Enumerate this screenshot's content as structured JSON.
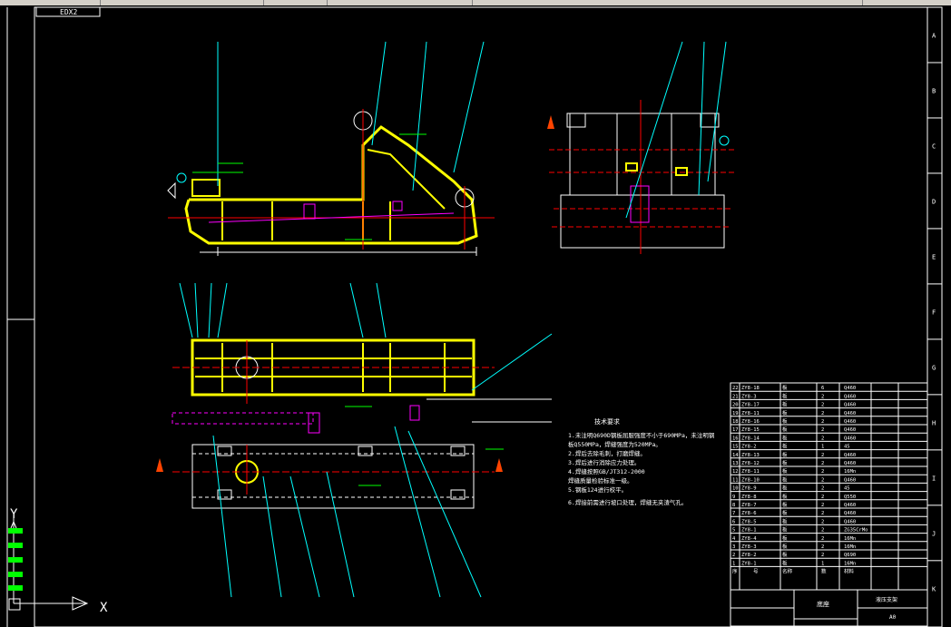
{
  "window": {
    "toolbar_segments": [
      "",
      "",
      "",
      "",
      ""
    ]
  },
  "drawing": {
    "tab_label": "EDX2",
    "border_letters": [
      "A",
      "B",
      "C",
      "D",
      "E",
      "F",
      "G",
      "H",
      "I",
      "J",
      "K"
    ],
    "axis_y_label": "Y",
    "axis_x_label": "X",
    "tech_requirements_title": "技术要求",
    "tech_requirements": [
      "1.未注明Q690D钢板屈服强度不小于690MPa，未注明钢",
      "  板Q550MPa，焊缝强度为520MPa。",
      "2.焊后去除毛刺，打磨焊缝。",
      "3.焊后进行消除应力处理。",
      "4.焊缝按照GB/JT312-2000",
      "  焊缝质量检验标准一级。",
      "5.钢板124进行校平。",
      "6.焊接前需进行坡口处理，焊缝无夹渣气孔。"
    ],
    "colors": {
      "background": "#000000",
      "frame": "#ffffff",
      "part": "#ffff00",
      "leader": "#00ffff",
      "center": "#ff0000",
      "dim": "#ff00ff",
      "green": "#00ff00"
    }
  },
  "bom": {
    "rows": [
      {
        "no": "22",
        "code": "ZY8-18",
        "name": "板",
        "qty": "6",
        "mat": "Q460"
      },
      {
        "no": "21",
        "code": "ZY8-3",
        "name": "板",
        "qty": "2",
        "mat": "Q460"
      },
      {
        "no": "20",
        "code": "ZY8-17",
        "name": "板",
        "qty": "2",
        "mat": "Q460"
      },
      {
        "no": "19",
        "code": "ZY8-11",
        "name": "板",
        "qty": "2",
        "mat": "Q460"
      },
      {
        "no": "18",
        "code": "ZY8-16",
        "name": "板",
        "qty": "2",
        "mat": "Q460"
      },
      {
        "no": "17",
        "code": "ZY8-15",
        "name": "板",
        "qty": "2",
        "mat": "Q460"
      },
      {
        "no": "16",
        "code": "ZY8-14",
        "name": "板",
        "qty": "2",
        "mat": "Q460"
      },
      {
        "no": "15",
        "code": "ZY8-2",
        "name": "板",
        "qty": "1",
        "mat": "45"
      },
      {
        "no": "14",
        "code": "ZY8-13",
        "name": "板",
        "qty": "2",
        "mat": "Q460"
      },
      {
        "no": "13",
        "code": "ZY8-12",
        "name": "板",
        "qty": "2",
        "mat": "Q460"
      },
      {
        "no": "12",
        "code": "ZY8-11",
        "name": "板",
        "qty": "2",
        "mat": "16Mn"
      },
      {
        "no": "11",
        "code": "ZY8-10",
        "name": "板",
        "qty": "2",
        "mat": "Q460"
      },
      {
        "no": "10",
        "code": "ZY8-9",
        "name": "板",
        "qty": "2",
        "mat": "45"
      },
      {
        "no": "9",
        "code": "ZY8-8",
        "name": "板",
        "qty": "2",
        "mat": "Q550"
      },
      {
        "no": "8",
        "code": "ZY8-7",
        "name": "板",
        "qty": "2",
        "mat": "Q460"
      },
      {
        "no": "7",
        "code": "ZY8-6",
        "name": "板",
        "qty": "2",
        "mat": "Q460"
      },
      {
        "no": "6",
        "code": "ZY8-5",
        "name": "板",
        "qty": "2",
        "mat": "Q460"
      },
      {
        "no": "5",
        "code": "ZY8-1",
        "name": "板",
        "qty": "2",
        "mat": "ZG35CrMo"
      },
      {
        "no": "4",
        "code": "ZY8-4",
        "name": "板",
        "qty": "2",
        "mat": "16Mn"
      },
      {
        "no": "3",
        "code": "ZY8-3",
        "name": "板",
        "qty": "2",
        "mat": "16Mn"
      },
      {
        "no": "2",
        "code": "ZY8-2",
        "name": "板",
        "qty": "2",
        "mat": "Q690"
      },
      {
        "no": "1",
        "code": "ZY8-1",
        "name": "板",
        "qty": "1",
        "mat": "16Mn"
      }
    ],
    "header": {
      "no": "序",
      "code": "号",
      "name": "名称",
      "qty": "数",
      "mat": "材料"
    },
    "title_name": "底座",
    "title_code": "液压支架",
    "title_sheet": "A0"
  }
}
